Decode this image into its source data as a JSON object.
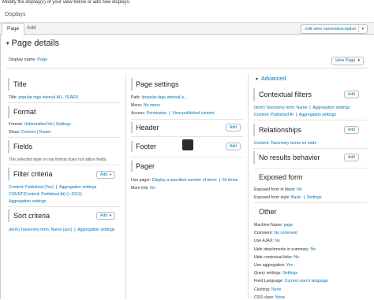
{
  "intro": "Modify the display(s) of your view below or add new displays.",
  "displays_label": "Displays",
  "tabs": {
    "page": "Page",
    "add": "Add"
  },
  "edit_view_btn": "edit view name/description",
  "details_title": "Page details",
  "display_name": {
    "label": "Display name:",
    "value": "Page"
  },
  "view_page_btn": "view Page",
  "add_label": "Add",
  "left": {
    "title": {
      "heading": "Title",
      "label": "Title:",
      "value": "popular tags interval ALL YEARS"
    },
    "format": {
      "heading": "Format",
      "label": "Format:",
      "value": "Unformatted list",
      "sep": "|",
      "settings": "Settings",
      "show_label": "Show:",
      "show_value": "Content",
      "teaser": "Teaser"
    },
    "fields": {
      "heading": "Fields",
      "note": "The selected style or row format does not utilize fields."
    },
    "filter": {
      "heading": "Filter criteria",
      "items": [
        "Content: Published (Yes)",
        "Aggregation settings",
        "COUNT(Content: Published At) (> 2016)",
        "Aggregation settings"
      ]
    },
    "sort": {
      "heading": "Sort criteria",
      "items": [
        "(term) Taxonomy term: Name (asc)",
        "Aggregation settings"
      ]
    }
  },
  "middle": {
    "page_settings": {
      "heading": "Page settings",
      "path_label": "Path:",
      "path_value": "/popular-tags-interval-a...",
      "menu_label": "Menu:",
      "menu_value": "No menu",
      "access_label": "Access:",
      "access_value": "Permission",
      "access_extra": "View published content"
    },
    "header": "Header",
    "footer": "Footer",
    "pager": {
      "heading": "Pager",
      "use_label": "Use pager:",
      "use_value": "Display a specified number of items",
      "use_count": "50 items",
      "more_label": "More link:",
      "more_value": "No"
    }
  },
  "right": {
    "advanced": "Advanced",
    "contextual": {
      "heading": "Contextual filters",
      "items": [
        "(term) Taxonomy term: Name",
        "Aggregation settings",
        "Content: Published At",
        "Aggregation settings"
      ]
    },
    "relationships": {
      "heading": "Relationships",
      "item": "Content: Taxonomy terms on node"
    },
    "no_results": "No results behavior",
    "exposed": {
      "heading": "Exposed form",
      "block_label": "Exposed form in block:",
      "block_value": "No",
      "style_label": "Exposed form style:",
      "style_value": "Basic",
      "style_settings": "Settings"
    },
    "other": {
      "heading": "Other",
      "rows": [
        {
          "label": "Machine Name:",
          "value": "page"
        },
        {
          "label": "Comment:",
          "value": "No comment"
        },
        {
          "label": "Use AJAX:",
          "value": "No"
        },
        {
          "label": "Hide attachments in summary:",
          "value": "No"
        },
        {
          "label": "Hide contextual links:",
          "value": "No"
        },
        {
          "label": "Use aggregation:",
          "value": "Yes"
        },
        {
          "label": "Query settings:",
          "value": "Settings"
        },
        {
          "label": "Field Language:",
          "value": "Current user's language"
        },
        {
          "label": "Caching:",
          "value": "None"
        },
        {
          "label": "CSS class:",
          "value": "None"
        }
      ]
    }
  }
}
